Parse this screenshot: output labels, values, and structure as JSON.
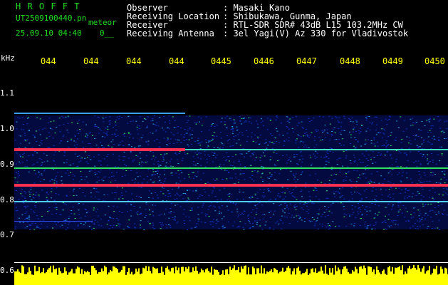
{
  "header": {
    "brand": "H R O F F T",
    "filename": "UT2509100440.pn",
    "mode": "meteor",
    "datetime": "25.09.10 04:40",
    "count": "0__",
    "info": [
      {
        "label": "Observer",
        "value": ": Masaki Kano"
      },
      {
        "label": "Receiving Location",
        "value": ": Shibukawa, Gunma, Japan"
      },
      {
        "label": "Receiver",
        "value": ": RTL-SDR SDR# 43dB L15 103.2MHz CW"
      },
      {
        "label": "Receiving Antenna",
        "value": ": 3el Yagi(V) Az 330 for Vladivostok"
      }
    ]
  },
  "axis": {
    "unit": "kHz",
    "y_ticks": [
      "1.1",
      "1.0",
      "0.9",
      "0.8",
      "0.7",
      "0.6"
    ],
    "x_ticks": [
      "044",
      "044",
      "044",
      "044",
      "0445",
      "0446",
      "0447",
      "0448",
      "0449",
      "0450"
    ]
  },
  "colors": {
    "background": "#000000",
    "header_green": "#22dd22",
    "axis_yellow": "#ffff00",
    "band_red": "#ff3050",
    "noise_blue": "#1030c0",
    "meteor_green": "#30e060"
  }
}
